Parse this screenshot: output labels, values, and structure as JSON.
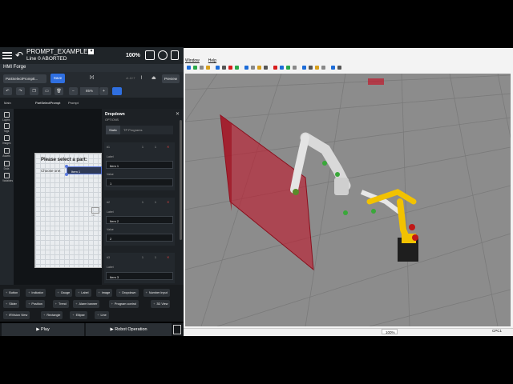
{
  "header": {
    "program_name": "PROMPT_EXAMPLE",
    "dropdown_glyph": "▾",
    "status_line": "Line 0 ABORTED",
    "percent": "100%",
    "icons": [
      "menu-icon",
      "back-arrow-icon",
      "edit-icon",
      "reset-icon",
      "hand-icon"
    ]
  },
  "forge": {
    "title": "HMI Forge"
  },
  "toolbar": {
    "page_select": "PartSelectPromptt...",
    "save_label": "Save",
    "code_icon": "[x]",
    "version": "v1.12.7",
    "preview_label": "Preview"
  },
  "toolbar2": {
    "zoom": "85%",
    "minus": "−",
    "plus": "+"
  },
  "breadcrumbs": [
    "Main",
    "PartSelectPrompt",
    "Prompt"
  ],
  "left_strip": [
    "Layers",
    "Tags",
    "Images",
    "Assets",
    "Data",
    "Variables"
  ],
  "canvas": {
    "title": "Please select a part:",
    "choose_label": "Choose one:",
    "choose_value": "Item 1",
    "small_label": "mm"
  },
  "panel": {
    "title": "Dropdown",
    "options_label": "OPTIONS",
    "tabs": [
      "Static",
      "TP Programs"
    ],
    "items": [
      {
        "id": "#1",
        "n1": "1",
        "n2": "1",
        "label_caption": "Label",
        "label": "Item 1",
        "value_caption": "Value",
        "value": "1"
      },
      {
        "id": "#2",
        "n1": "1",
        "n2": "1",
        "label_caption": "Label",
        "label": "Item 2",
        "value_caption": "Value",
        "value": "2"
      },
      {
        "id": "#3",
        "n1": "1",
        "n2": "1",
        "label_caption": "Label",
        "label": "Item 3"
      }
    ],
    "remove_glyph": "✕"
  },
  "palette": {
    "row1": [
      "Button",
      "Indicator",
      "Gauge",
      "Label",
      "Image",
      "Dropdown",
      "Number Input"
    ],
    "row2": [
      "Slider",
      "Position",
      "Trend",
      "Alarm banner",
      "Program control",
      "3D View"
    ],
    "row3": [
      "iRVision View",
      "Rectangle",
      "Ellipse",
      "Line"
    ],
    "plus": "+"
  },
  "bottom": {
    "play": "Play",
    "robot_operation": "Robot Operation"
  },
  "right_app": {
    "menu": [
      "Window",
      "Help"
    ],
    "zoom": "100%",
    "controller": "CPC1"
  },
  "colors": {
    "accent": "#2f6fe0",
    "wall": "#c0182b",
    "robot_yellow": "#f2c200"
  }
}
